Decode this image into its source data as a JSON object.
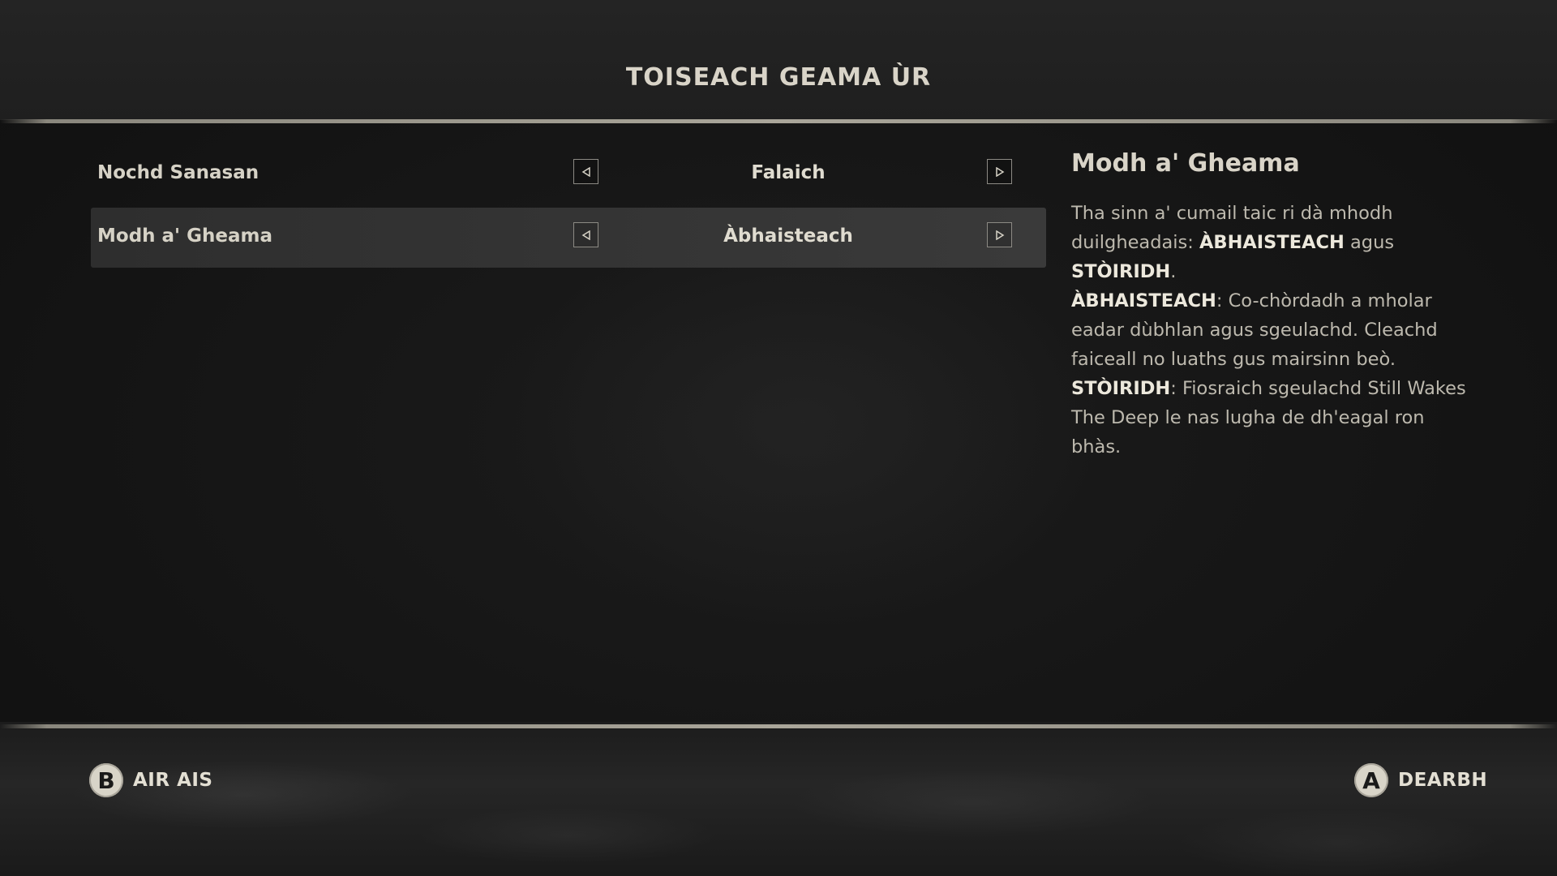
{
  "header": {
    "title": "TOISEACH GEAMA ÙR"
  },
  "options": [
    {
      "label": "Nochd Sanasan",
      "value": "Falaich",
      "selected": false
    },
    {
      "label": "Modh a' Gheama",
      "value": "Àbhaisteach",
      "selected": true
    }
  ],
  "description": {
    "title": "Modh a' Gheama",
    "intro": "Tha sinn a' cumail taic ri dà mhodh duilgheadais: ",
    "mode1": "ÀBHAISTEACH",
    "conj": " agus ",
    "mode2": "STÒIRIDH",
    "period": ".",
    "mode1_heading": "ÀBHAISTEACH",
    "mode1_text": ": Co-chòrdadh a mholar eadar dùbhlan agus sgeulachd. Cleachd faiceall no luaths gus mairsinn beò.",
    "mode2_heading": "STÒIRIDH",
    "mode2_text": ": Fiosraich sgeulachd Still Wakes The Deep le nas lugha de dh'eagal ron bhàs."
  },
  "footer": {
    "back": {
      "glyph": "B",
      "label": "AIR AIS"
    },
    "confirm": {
      "glyph": "A",
      "label": "DEARBH"
    }
  },
  "colors": {
    "background": "#141414",
    "text": "#d6d2c6",
    "selected_row": "#353535",
    "rule": "#aaa69a"
  }
}
